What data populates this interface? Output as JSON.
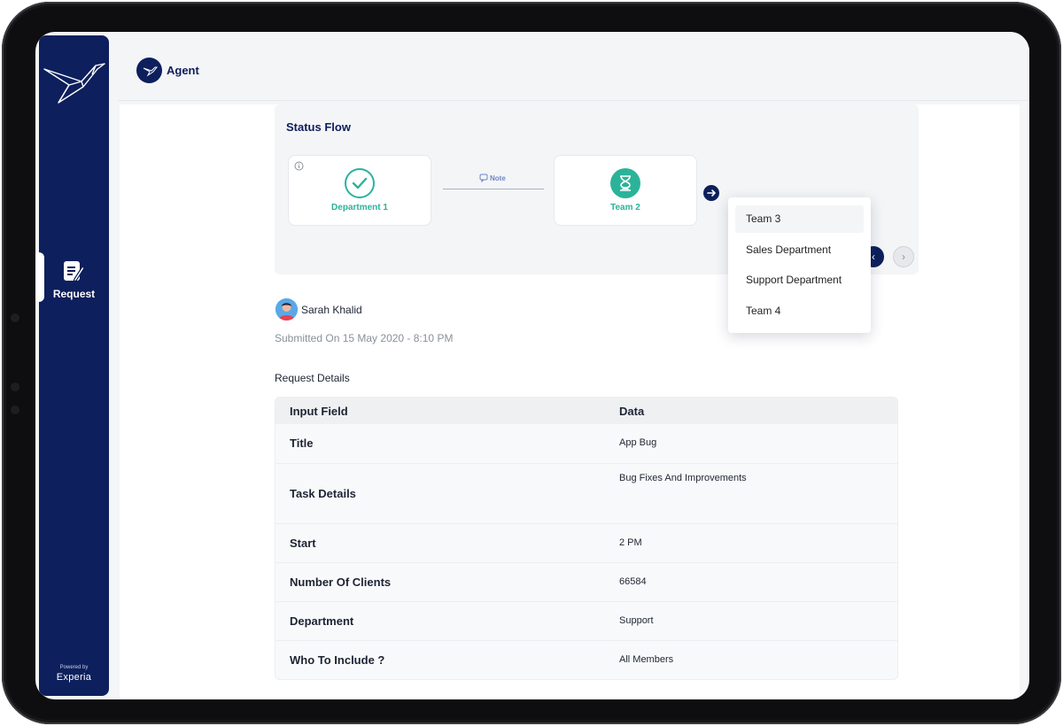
{
  "sidebar": {
    "nav_label": "Request",
    "powered_by": "Powered by",
    "brand": "Experia"
  },
  "header": {
    "title": "Agent"
  },
  "status_flow": {
    "title": "Status Flow",
    "steps": [
      {
        "label": "Department 1",
        "state": "done"
      },
      {
        "label": "Team 2",
        "state": "in-progress"
      }
    ],
    "note_label": "Note",
    "dropdown": [
      "Team 3",
      "Sales Department",
      "Support Department",
      "Team 4"
    ],
    "prev_glyph": "‹",
    "next_glyph": "›"
  },
  "request": {
    "user_name": "Sarah Khalid",
    "submitted": "Submitted On 15 May 2020 - 8:10 PM",
    "section_title": "Request Details",
    "columns": [
      "Input Field",
      "Data"
    ],
    "rows": [
      {
        "field": "Title",
        "value": "App Bug"
      },
      {
        "field": "Task Details",
        "value": "Bug Fixes And Improvements"
      },
      {
        "field": "Start",
        "value": "2 PM"
      },
      {
        "field": "Number Of Clients",
        "value": "66584"
      },
      {
        "field": "Department",
        "value": "Support"
      },
      {
        "field": "Who To Include ?",
        "value": "All Members"
      }
    ]
  },
  "colors": {
    "navy": "#0d1f5c",
    "teal": "#2bb39a"
  }
}
